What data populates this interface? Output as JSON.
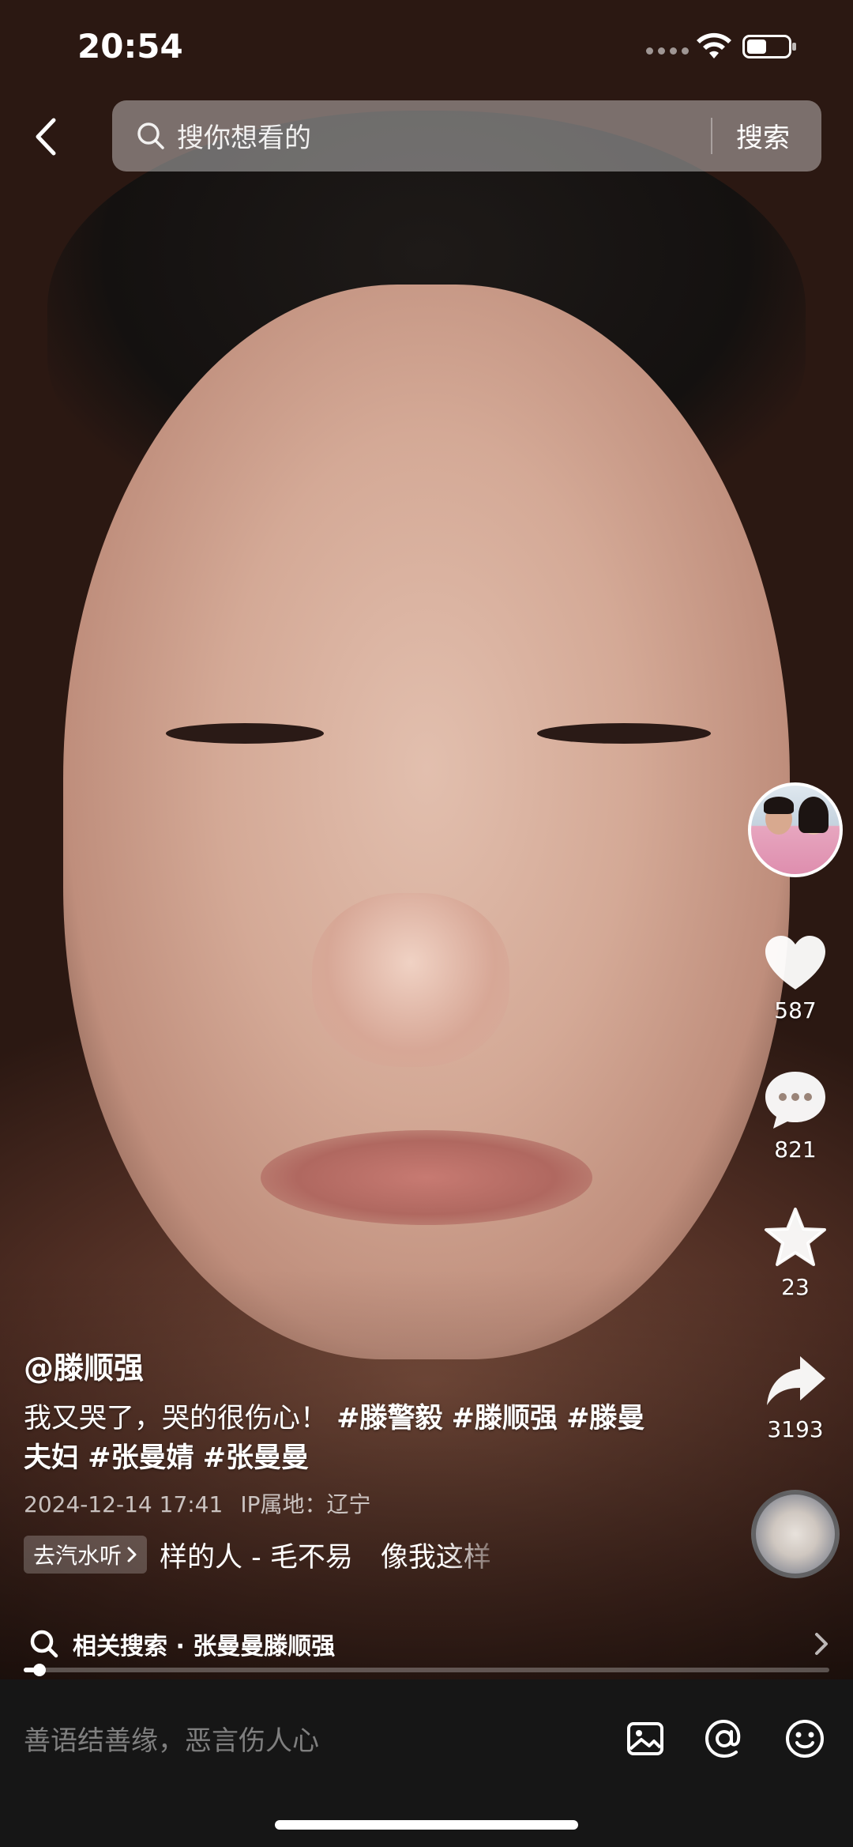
{
  "status_bar": {
    "time": "20:54"
  },
  "search": {
    "placeholder": "搜你想看的",
    "button_label": "搜索"
  },
  "actions": {
    "like_count": "587",
    "comment_count": "821",
    "favorite_count": "23",
    "share_count": "3193"
  },
  "post": {
    "author": "@滕顺强",
    "caption_text": "我又哭了，哭的很伤心！",
    "hashtags": [
      "#滕警毅",
      "#滕顺强",
      "#滕曼夫妇",
      "#张曼婧",
      "#张曼曼"
    ],
    "date": "2024-12-14 17:41",
    "ip_location": "IP属地：辽宁"
  },
  "music": {
    "chip_label": "去汽水听",
    "title": "样的人 - 毛不易　像我这样"
  },
  "related_search": {
    "label": "相关搜索 · 张曼曼滕顺强"
  },
  "playback": {
    "progress_fraction": 0.02
  },
  "comment_bar": {
    "placeholder": "善语结善缘，恶言伤人心"
  },
  "icons": [
    "back-chevron-icon",
    "search-icon",
    "heart-icon",
    "comment-bubble-icon",
    "star-icon",
    "share-arrow-icon",
    "image-icon",
    "at-mention-icon",
    "emoji-icon",
    "chevron-right-icon"
  ]
}
